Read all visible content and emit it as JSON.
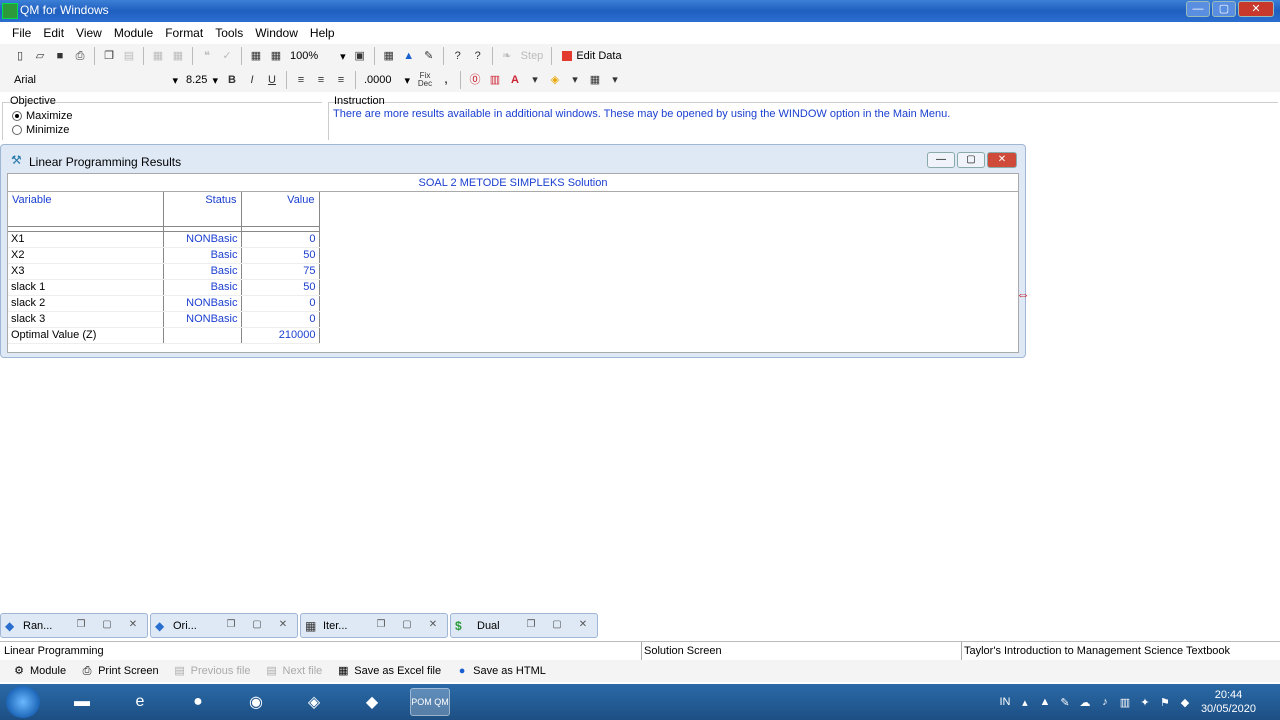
{
  "window": {
    "title": "QM for Windows",
    "controls": {
      "minimize": "—",
      "maximize": "▢",
      "close": "✕"
    }
  },
  "menu": [
    "File",
    "Edit",
    "View",
    "Module",
    "Format",
    "Tools",
    "Window",
    "Help"
  ],
  "toolbar": {
    "zoom": "100%",
    "step_label": "Step",
    "edit_data_label": "Edit Data",
    "font_name": "Arial",
    "font_size": "8.25",
    "bold": "B",
    "italic": "I",
    "underline": "U",
    "number_format": ".0000",
    "fix_dec_label": "Fix Dec",
    "comma": ","
  },
  "objective": {
    "label": "Objective",
    "options": [
      "Maximize",
      "Minimize"
    ],
    "selected": "Maximize"
  },
  "instruction": {
    "label": "Instruction",
    "text": "There are more results available in additional windows. These may be opened by using the WINDOW option in the Main Menu."
  },
  "results_window": {
    "title": "Linear Programming Results",
    "solution_title": "SOAL 2 METODE SIMPLEKS Solution",
    "columns": [
      "Variable",
      "Status",
      "Value"
    ],
    "rows": [
      {
        "variable": "X1",
        "status": "NONBasic",
        "value": "0"
      },
      {
        "variable": "X2",
        "status": "Basic",
        "value": "50"
      },
      {
        "variable": "X3",
        "status": "Basic",
        "value": "75"
      },
      {
        "variable": "slack 1",
        "status": "Basic",
        "value": "50"
      },
      {
        "variable": "slack 2",
        "status": "NONBasic",
        "value": "0"
      },
      {
        "variable": "slack 3",
        "status": "NONBasic",
        "value": "0"
      },
      {
        "variable": "Optimal Value (Z)",
        "status": "",
        "value": "210000"
      }
    ]
  },
  "minimized_windows": [
    "Ran...",
    "Ori...",
    "Iter...",
    "Dual"
  ],
  "statusbar": {
    "left": "Linear Programming",
    "middle": "Solution Screen",
    "right": "Taylor's Introduction to Management Science Textbook"
  },
  "actions": {
    "module": "Module",
    "print_screen": "Print Screen",
    "previous_file": "Previous file",
    "next_file": "Next file",
    "save_excel": "Save as Excel file",
    "save_html": "Save as HTML"
  },
  "taskbar": {
    "language": "IN",
    "time": "20:44",
    "date": "30/05/2020",
    "pom_label": "POM QM"
  }
}
